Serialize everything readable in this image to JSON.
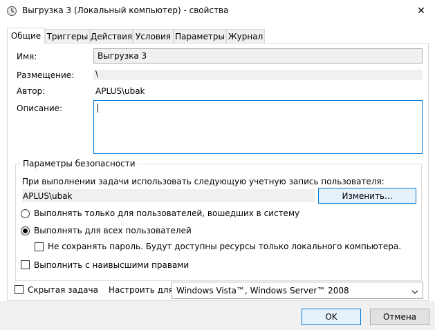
{
  "window": {
    "title": "Выгрузка 3 (Локальный компьютер) - свойства",
    "close_symbol": "✕",
    "icon": "task-scheduler-icon"
  },
  "tabs": [
    {
      "label": "Общие",
      "active": true
    },
    {
      "label": "Триггеры",
      "active": false
    },
    {
      "label": "Действия",
      "active": false
    },
    {
      "label": "Условия",
      "active": false
    },
    {
      "label": "Параметры",
      "active": false
    },
    {
      "label": "Журнал",
      "active": false
    }
  ],
  "general": {
    "name_label": "Имя:",
    "name_value": "Выгрузка 3",
    "location_label": "Размещение:",
    "location_value": "\\",
    "author_label": "Автор:",
    "author_value": "APLUS\\ubak",
    "description_label": "Описание:",
    "description_value": ""
  },
  "security": {
    "group_title": "Параметры безопасности",
    "run_as_text": "При выполнении задачи использовать следующую учетную запись пользователя:",
    "account_value": "APLUS\\ubak",
    "change_button": "Изменить...",
    "radio_logged_on": "Выполнять только для пользователей, вошедших в систему",
    "radio_all_users": "Выполнять для всех пользователей",
    "selected_radio": "all_users",
    "no_store_password": "Не сохранять пароль. Будут доступны ресурсы только локального компьютера.",
    "no_store_password_checked": false,
    "highest_privileges": "Выполнить с наивысшими правами",
    "highest_privileges_checked": false
  },
  "footer": {
    "hidden_task": "Скрытая задача",
    "hidden_task_checked": false,
    "configure_label": "Настроить для:",
    "configure_value": "Windows Vista™, Windows Server™ 2008"
  },
  "buttons": {
    "ok": "OK",
    "cancel": "Отмена"
  },
  "colors": {
    "accent": "#0078d7",
    "readonly_bg": "#f0f0f0"
  }
}
